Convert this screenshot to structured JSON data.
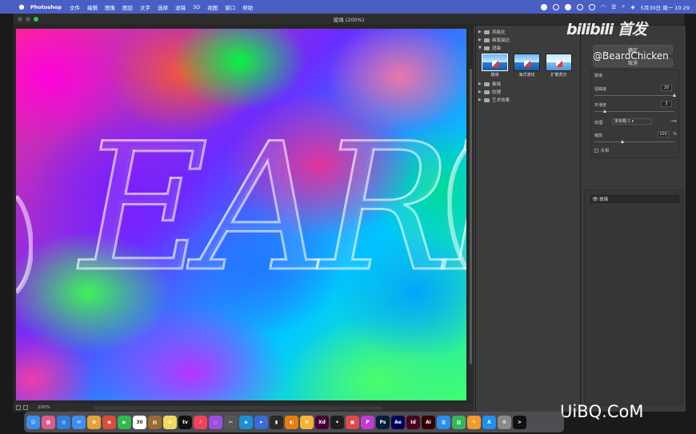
{
  "menubar": {
    "app_name": "Photoshop",
    "menus": [
      "文件",
      "编辑",
      "图像",
      "图层",
      "文字",
      "选择",
      "滤镜",
      "3D",
      "视图",
      "窗口",
      "帮助"
    ],
    "clock": "5月30日 周一  10:29"
  },
  "window": {
    "document_title": "玻璃 (200%)"
  },
  "status": {
    "zoom": "200%"
  },
  "filter_gallery": {
    "categories": [
      {
        "label": "风格化",
        "expanded": false
      },
      {
        "label": "画笔描边",
        "expanded": false
      },
      {
        "label": "扭曲",
        "expanded": true
      },
      {
        "label": "素描",
        "expanded": false
      },
      {
        "label": "纹理",
        "expanded": false
      },
      {
        "label": "艺术效果",
        "expanded": false
      }
    ],
    "distort_filters": [
      {
        "label": "玻璃",
        "selected": true
      },
      {
        "label": "海洋波纹",
        "selected": false
      },
      {
        "label": "扩散亮光",
        "selected": false
      }
    ]
  },
  "settings": {
    "ok_label": "确定",
    "cancel_label": "取消",
    "filter_name": "玻璃",
    "distortion": {
      "label": "扭曲度",
      "value": "20",
      "fraction": 1.0
    },
    "smoothness": {
      "label": "平滑度",
      "value": "3",
      "fraction": 0.13
    },
    "texture": {
      "label": "纹理:",
      "value": "未标题-1"
    },
    "scaling": {
      "label": "缩放",
      "value": "100",
      "unit": "%",
      "fraction": 0.35
    },
    "invert": {
      "label": "反相",
      "checked": false
    },
    "effect_layer": {
      "label": "玻璃"
    }
  },
  "watermarks": {
    "bilibili": "bilibili 首发",
    "user": "@BeardChicken",
    "site": "UiBQ.CoM"
  },
  "canvas": {
    "text": "EARR"
  },
  "dock": {
    "calendar_day": "30",
    "apps": [
      {
        "name": "finder",
        "color": "#3b8df0",
        "glyph": "☺"
      },
      {
        "name": "launchpad",
        "color": "#e05a8a",
        "glyph": "▦"
      },
      {
        "name": "safari",
        "color": "#2f7de0",
        "glyph": "◎"
      },
      {
        "name": "mail",
        "color": "#3e8ef5",
        "glyph": "✉"
      },
      {
        "name": "photos",
        "color": "#e7a23b",
        "glyph": "✿"
      },
      {
        "name": "chrome",
        "color": "#dd4b39",
        "glyph": "◉"
      },
      {
        "name": "facetime",
        "color": "#2fb84c",
        "glyph": "▶"
      },
      {
        "name": "calendar",
        "color": "#ffffff",
        "glyph": ""
      },
      {
        "name": "notes-brown",
        "color": "#9b6b35",
        "glyph": "▤"
      },
      {
        "name": "notes",
        "color": "#f2d95c",
        "glyph": "≡"
      },
      {
        "name": "apple-tv",
        "color": "#111111",
        "glyph": "tv"
      },
      {
        "name": "music",
        "color": "#f2415b",
        "glyph": "♪"
      },
      {
        "name": "podcasts",
        "color": "#9b4ee0",
        "glyph": "◌"
      },
      {
        "name": "final-cut",
        "color": "#555555",
        "glyph": "✂"
      },
      {
        "name": "edge",
        "color": "#1d8fd6",
        "glyph": "e"
      },
      {
        "name": "arrow-app",
        "color": "#3a6bd8",
        "glyph": "➤"
      },
      {
        "name": "media-encoder",
        "color": "#2a2a2a",
        "glyph": "▮"
      },
      {
        "name": "blender",
        "color": "#e87d0d",
        "glyph": "◐"
      },
      {
        "name": "preview",
        "color": "#f4b43a",
        "glyph": "❦"
      },
      {
        "name": "xd",
        "color": "#470137",
        "glyph": "Xd"
      },
      {
        "name": "figma",
        "color": "#1e1e1e",
        "glyph": "✦"
      },
      {
        "name": "screen",
        "color": "#e24a4a",
        "glyph": "▣"
      },
      {
        "name": "picsart",
        "color": "#c13bd6",
        "glyph": "P"
      },
      {
        "name": "photoshop",
        "color": "#001e36",
        "glyph": "Ps"
      },
      {
        "name": "after-effects",
        "color": "#00005b",
        "glyph": "Ae"
      },
      {
        "name": "indesign",
        "color": "#49021f",
        "glyph": "Id"
      },
      {
        "name": "illustrator",
        "color": "#330000",
        "glyph": "Ai"
      },
      {
        "name": "keynote",
        "color": "#2c8cf0",
        "glyph": "▥"
      },
      {
        "name": "numbers",
        "color": "#34b65a",
        "glyph": "▧"
      },
      {
        "name": "pages",
        "color": "#f29a2e",
        "glyph": "✎"
      },
      {
        "name": "app-store",
        "color": "#1f8ff2",
        "glyph": "A"
      },
      {
        "name": "settings",
        "color": "#8a8a8a",
        "glyph": "⚙"
      },
      {
        "name": "terminal",
        "color": "#111111",
        "glyph": ">"
      }
    ]
  },
  "colors": {
    "menubar": "#4a5fc4",
    "panel": "#3a3a3a",
    "accent_green": "#36c24a"
  }
}
